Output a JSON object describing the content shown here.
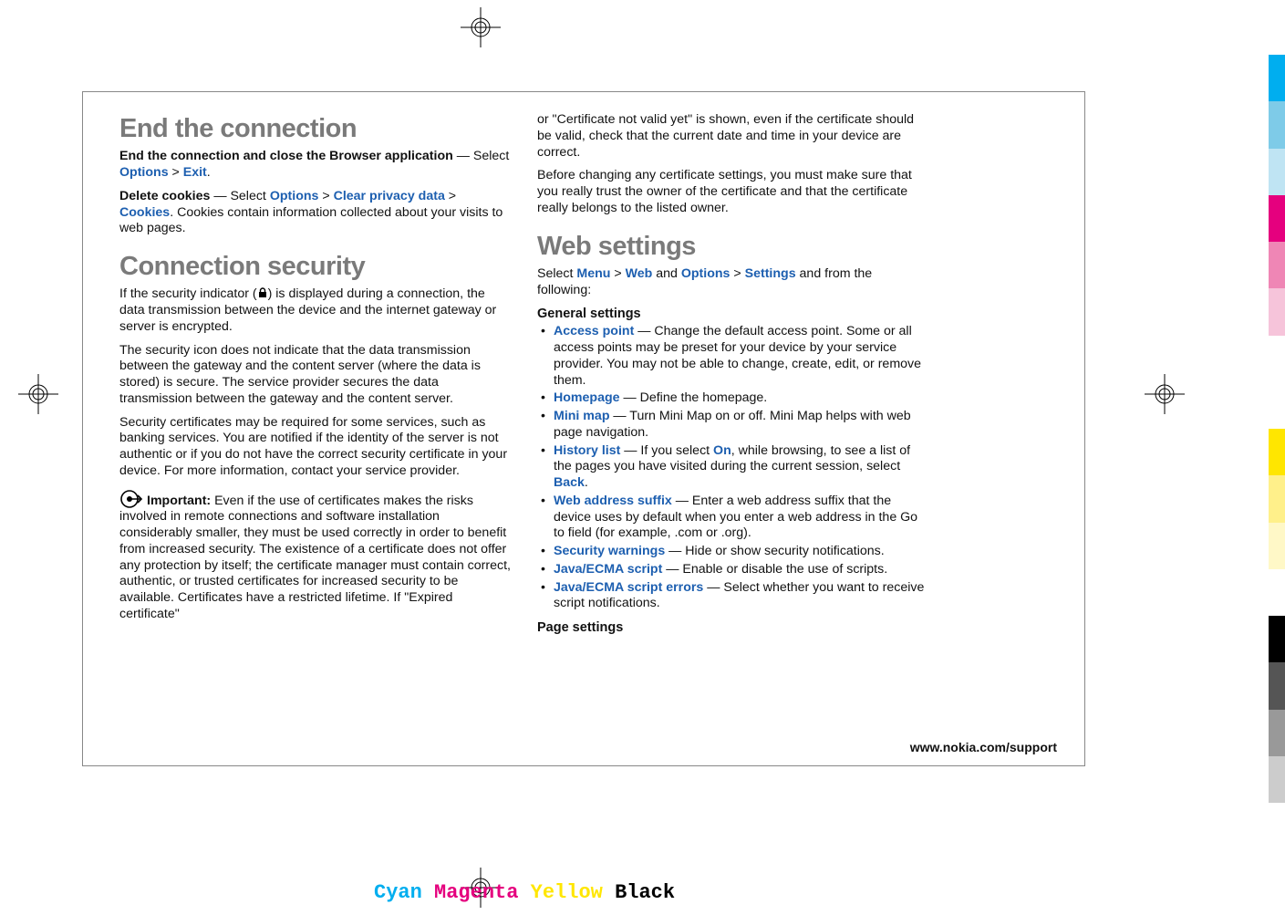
{
  "left": {
    "h1a": "End the connection",
    "p1_bold": "End the connection and close the Browser application",
    "p1_rest": " —  Select ",
    "p1_opt": "Options",
    "p1_gt": " > ",
    "p1_exit": "Exit",
    "p1_end": ".",
    "p2_bold": "Delete cookies",
    "p2_a": "  —  Select ",
    "p2_opt": "Options",
    "p2_gt1": " > ",
    "p2_clear": "Clear privacy data",
    "p2_gt2": " > ",
    "p2_cookies": "Cookies",
    "p2_end": ". Cookies contain information collected about your visits to web pages.",
    "h1b": "Connection security",
    "p3_a": "If the security indicator (",
    "p3_b": ") is displayed during a connection, the data transmission between the device and the internet gateway or server is encrypted.",
    "p4": "The security icon does not indicate that the data transmission between the gateway and the content server (where the data is stored) is secure. The service provider secures the data transmission between the gateway and the content server.",
    "p5": "Security certificates may be required for some services, such as banking services. You are notified if the identity of the server is not authentic or if you do not have the correct security certificate in your device. For more information, contact your service provider.",
    "imp_label": "Important:",
    "imp_text": "  Even if the use of certificates makes the risks involved in remote connections and software installation considerably smaller, they must be used correctly in order to benefit from increased security. The existence of a certificate does not offer any protection by itself; the certificate manager must contain correct, authentic, or trusted certificates for increased security to be available. Certificates have a restricted lifetime. If \"Expired certificate\""
  },
  "right": {
    "p_cont": "or \"Certificate not valid yet\" is shown, even if the certificate should be valid, check that the current date and time in your device are correct.",
    "p_before": "Before changing any certificate settings, you must make sure that you really trust the owner of the certificate and that the certificate really belongs to the listed owner.",
    "h1": "Web settings",
    "sel_a": "Select ",
    "sel_menu": "Menu",
    "sel_gt1": " > ",
    "sel_web": "Web",
    "sel_and": " and ",
    "sel_opt": "Options",
    "sel_gt2": " > ",
    "sel_set": "Settings",
    "sel_end": " and from the following:",
    "h2a": "General settings",
    "items": [
      {
        "kw": "Access point",
        "txt": " — Change the default access point. Some or all access points may be preset for your device by your service provider. You may not be able to change, create, edit, or remove them."
      },
      {
        "kw": "Homepage",
        "txt": " — Define the homepage."
      },
      {
        "kw": "Mini map",
        "txt": " — Turn Mini Map on or off. Mini Map helps with web page navigation."
      },
      {
        "kw": "History list",
        "txt_a": " — If you select ",
        "kw2": "On",
        "txt_b": ", while browsing, to see a list of the pages you have visited during the current session, select ",
        "kw3": "Back",
        "txt_c": "."
      },
      {
        "kw": "Web address suffix",
        "txt": " — Enter a web address suffix that the device uses by default when you enter a web address in the Go to field (for example, .com or .org)."
      },
      {
        "kw": "Security warnings",
        "txt": " — Hide or show security notifications."
      },
      {
        "kw": "Java/ECMA script",
        "txt": " — Enable or disable the use of scripts."
      },
      {
        "kw": "Java/ECMA script errors",
        "txt": " — Select whether you want to receive script notifications."
      }
    ],
    "h2b": "Page settings"
  },
  "footer_url": "www.nokia.com/support",
  "cmyk": {
    "c": "Cyan",
    "m": "Magenta",
    "y": "Yellow",
    "k": "Black"
  },
  "colorbar": [
    "#00aeef",
    "#7ecbe8",
    "#bfe4f3",
    "#e5007e",
    "#ef86b5",
    "#f6c4da",
    "#ffffff",
    "#ffffff",
    "#ffe600",
    "#fff08a",
    "#fff8c7",
    "#ffffff",
    "#000000",
    "#555555",
    "#999999",
    "#cccccc"
  ]
}
